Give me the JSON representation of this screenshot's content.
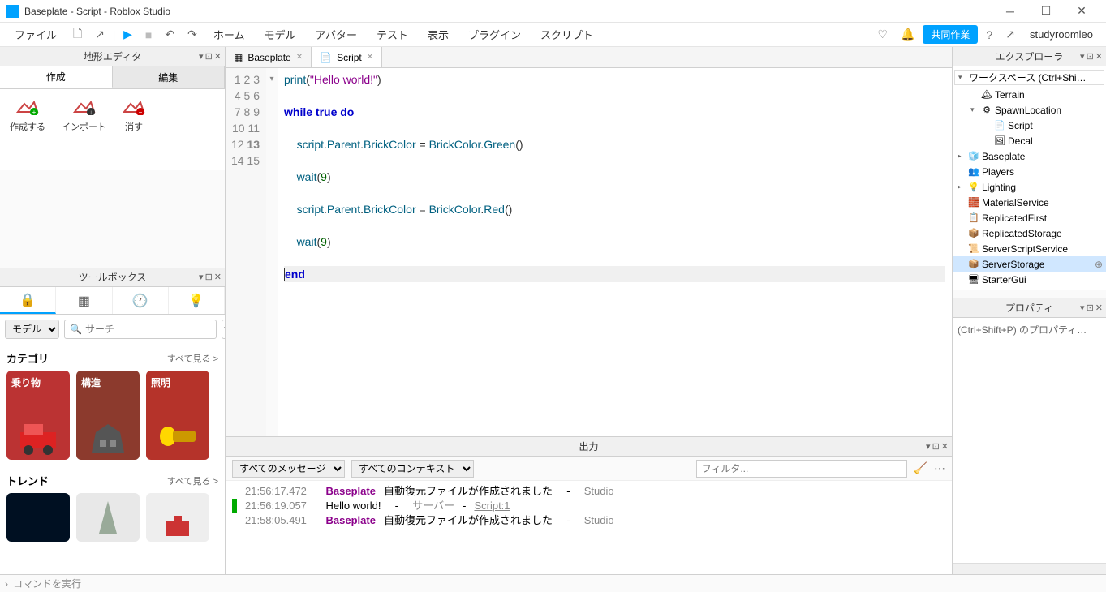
{
  "window": {
    "title": "Baseplate - Script - Roblox Studio"
  },
  "menu": {
    "file": "ファイル",
    "items": [
      "ホーム",
      "モデル",
      "アバター",
      "テスト",
      "表示",
      "プラグイン",
      "スクリプト"
    ],
    "collab": "共同作業",
    "username": "studyroomleo"
  },
  "terrain": {
    "title": "地形エディタ",
    "tabs": {
      "create": "作成",
      "edit": "編集"
    },
    "buttons": {
      "create": "作成する",
      "import": "インポート",
      "clear": "消す"
    }
  },
  "toolbox": {
    "title": "ツールボックス",
    "model_type": "モデル",
    "search_placeholder": "サーチ",
    "categories": {
      "label": "カテゴリ",
      "more": "すべて見る >",
      "items": [
        "乗り物",
        "構造",
        "照明"
      ]
    },
    "trend": {
      "label": "トレンド",
      "more": "すべて見る >"
    }
  },
  "doctabs": [
    {
      "icon": "📄",
      "label": "Baseplate"
    },
    {
      "icon": "📄",
      "label": "Script"
    }
  ],
  "code": {
    "lines": [
      1,
      2,
      3,
      4,
      5,
      6,
      7,
      8,
      9,
      10,
      11,
      12,
      13,
      14,
      15
    ]
  },
  "output": {
    "title": "出力",
    "msg_filter": "すべてのメッセージ",
    "ctx_filter": "すべてのコンテキスト",
    "filter_placeholder": "フィルタ...",
    "rows": [
      {
        "ts": "21:56:17.472",
        "bold": "Baseplate",
        "msg": "自動復元ファイルが作成されました",
        "src": "Studio",
        "green": false
      },
      {
        "ts": "21:56:19.057",
        "plain": "Hello world!",
        "server": "サーバー",
        "link": "Script:1",
        "green": true
      },
      {
        "ts": "21:58:05.491",
        "bold": "Baseplate",
        "msg": "自動復元ファイルが作成されました",
        "src": "Studio",
        "green": false
      }
    ]
  },
  "explorer": {
    "title": "エクスプローラ",
    "search": "ワークスペース (Ctrl+Shi…",
    "tree": [
      {
        "indent": 1,
        "arrow": "",
        "icon": "🏔",
        "label": "Terrain"
      },
      {
        "indent": 1,
        "arrow": "▾",
        "icon": "⚙",
        "label": "SpawnLocation"
      },
      {
        "indent": 2,
        "arrow": "",
        "icon": "📄",
        "label": "Script"
      },
      {
        "indent": 2,
        "arrow": "",
        "icon": "🖼",
        "label": "Decal"
      },
      {
        "indent": 0,
        "arrow": "▸",
        "icon": "🧊",
        "label": "Baseplate"
      },
      {
        "indent": 0,
        "arrow": "",
        "icon": "👥",
        "label": "Players"
      },
      {
        "indent": 0,
        "arrow": "▸",
        "icon": "💡",
        "label": "Lighting"
      },
      {
        "indent": 0,
        "arrow": "",
        "icon": "🧱",
        "label": "MaterialService"
      },
      {
        "indent": 0,
        "arrow": "",
        "icon": "📋",
        "label": "ReplicatedFirst"
      },
      {
        "indent": 0,
        "arrow": "",
        "icon": "📦",
        "label": "ReplicatedStorage"
      },
      {
        "indent": 0,
        "arrow": "",
        "icon": "📜",
        "label": "ServerScriptService"
      },
      {
        "indent": 0,
        "arrow": "",
        "icon": "📦",
        "label": "ServerStorage",
        "selected": true,
        "plus": true
      },
      {
        "indent": 0,
        "arrow": "",
        "icon": "🖥",
        "label": "StarterGui"
      }
    ]
  },
  "properties": {
    "title": "プロパティ",
    "hint": "(Ctrl+Shift+P) のプロパティ…"
  },
  "cmd": {
    "placeholder": "コマンドを実行"
  }
}
